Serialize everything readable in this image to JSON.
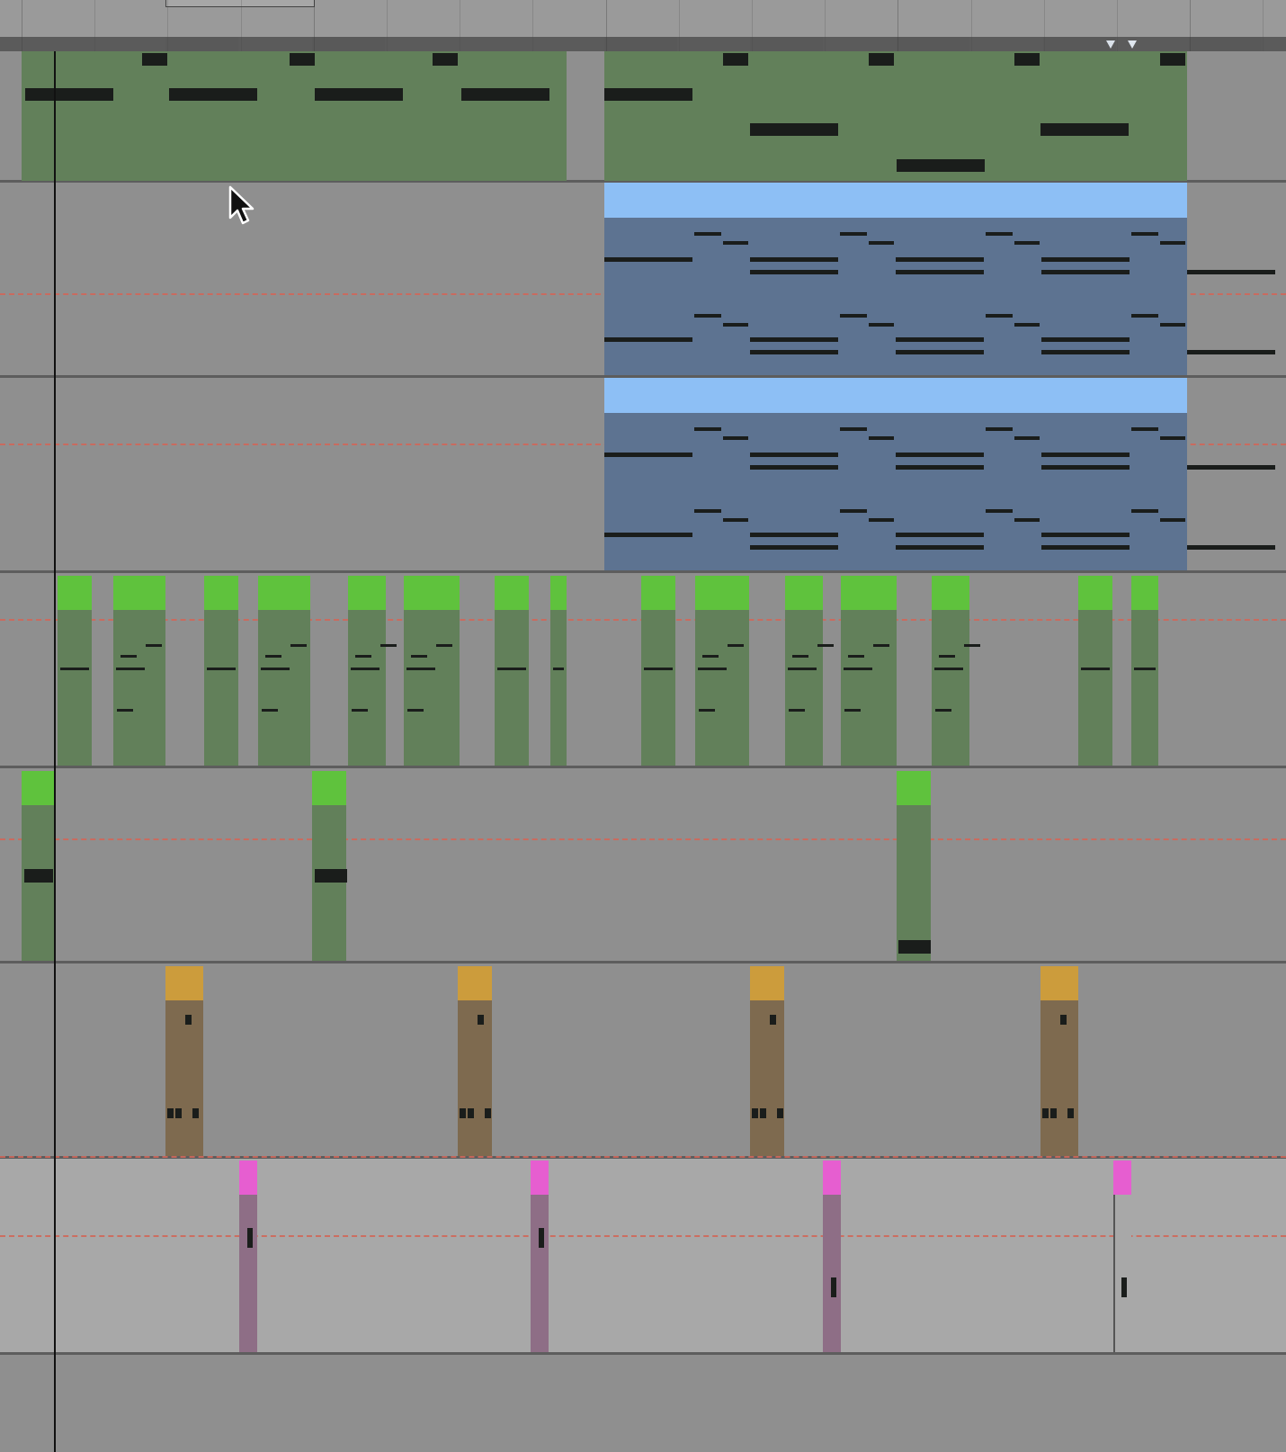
{
  "arrangement": {
    "view": "arrangement",
    "colors": {
      "lane_bg": "#8f8f8f",
      "lane_bg_light": "#a8a8a8",
      "clip_green": "#62805a",
      "clip_green_head": "#5fc23d",
      "clip_blue": "#5d7391",
      "clip_blue_head": "#8dbff5",
      "clip_brown": "#7e6a4f",
      "clip_brown_head": "#cc9c3c",
      "clip_purple": "#8e6e86",
      "clip_purple_head": "#e65ed0",
      "note": "#1a1d1b",
      "automation_dash": "#d0685a",
      "playhead": "#111111"
    },
    "tracks": [
      {
        "name": "",
        "clip_color": "green"
      },
      {
        "name": "",
        "clip_color": "blue"
      },
      {
        "name": "",
        "clip_color": "blue"
      },
      {
        "name": "",
        "clip_color": "green"
      },
      {
        "name": "",
        "clip_color": "green"
      },
      {
        "name": "",
        "clip_color": "brown"
      },
      {
        "name": "",
        "clip_color": "purple"
      }
    ],
    "icons": {
      "cursor": "mouse-pointer-icon",
      "loop_start": "loop-start-marker-icon",
      "loop_end": "loop-end-marker-icon"
    }
  }
}
